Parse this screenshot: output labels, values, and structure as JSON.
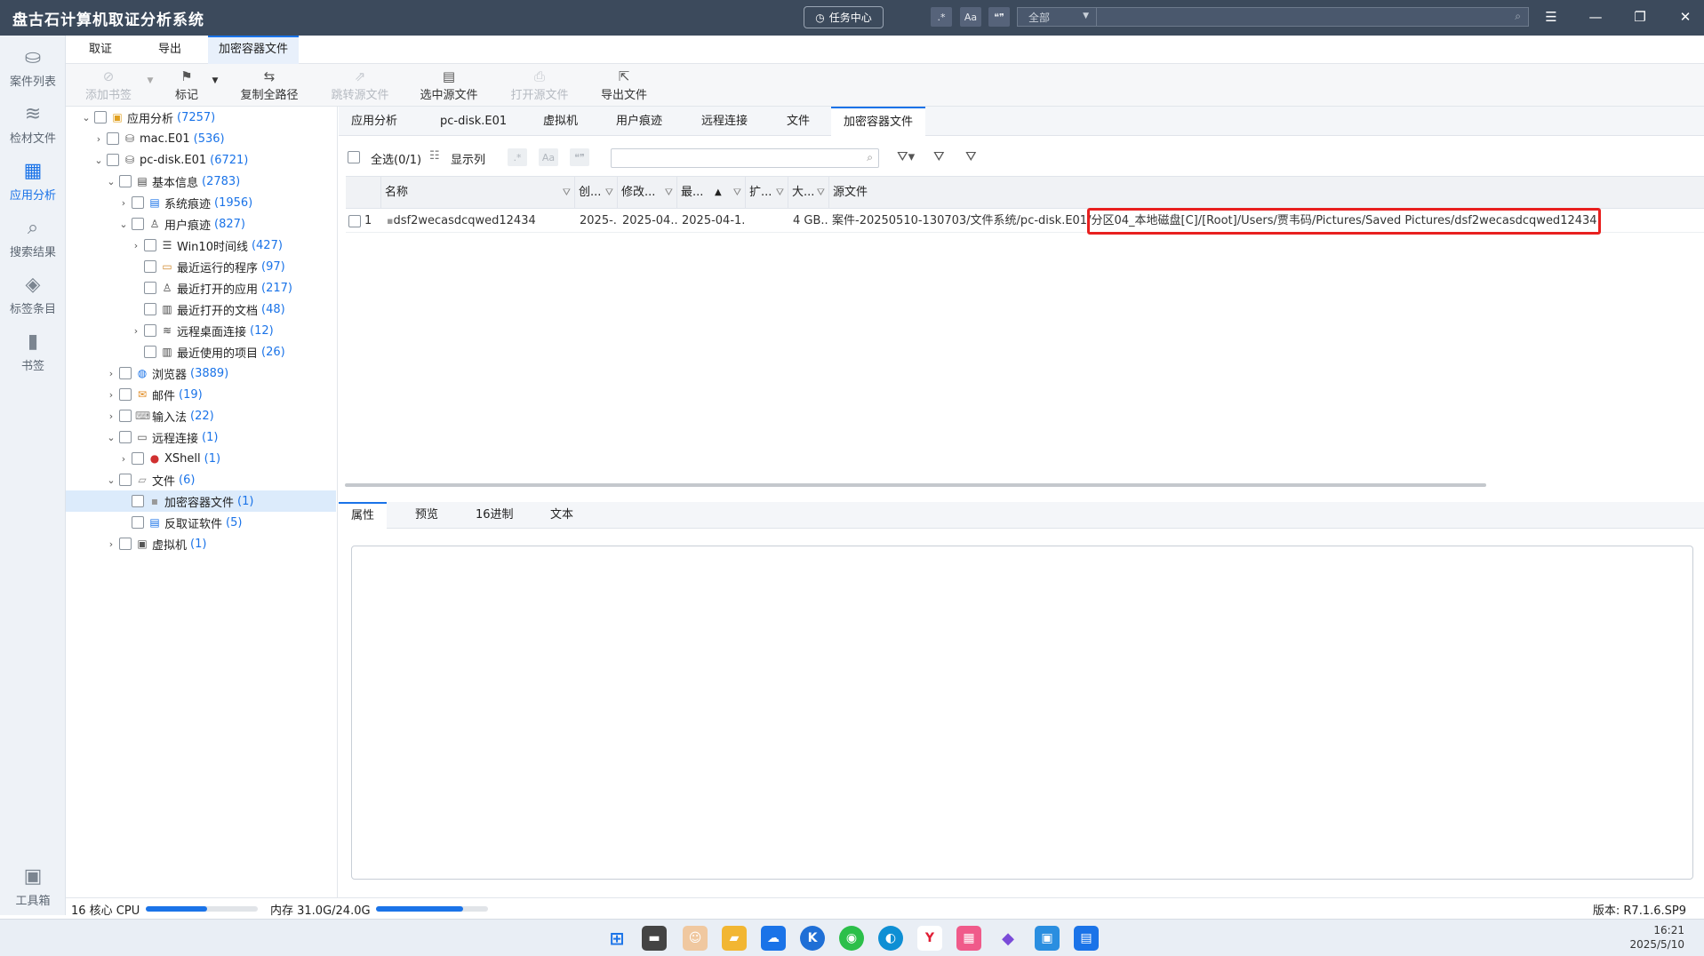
{
  "app": {
    "title": "盘古石计算机取证分析系统",
    "task_center": "任务中心",
    "scope": "全部"
  },
  "title_tools": [
    ".*",
    "Aa",
    "❝❞"
  ],
  "leftnav": [
    {
      "label": "案件列表",
      "icon": "case-list-icon"
    },
    {
      "label": "检材文件",
      "icon": "layers-icon"
    },
    {
      "label": "应用分析",
      "icon": "grid-apps-icon"
    },
    {
      "label": "搜索结果",
      "icon": "search-doc-icon"
    },
    {
      "label": "标签条目",
      "icon": "tag-icon"
    },
    {
      "label": "书签",
      "icon": "bookmark-icon"
    },
    {
      "label": "工具箱",
      "icon": "toolbox-icon"
    }
  ],
  "menu_tabs": [
    "取证",
    "导出",
    "加密容器文件"
  ],
  "toolbar": [
    {
      "label": "添加书签",
      "disabled": true
    },
    {
      "label": "标记",
      "disabled": false
    },
    {
      "label": "复制全路径",
      "disabled": false
    },
    {
      "label": "跳转源文件",
      "disabled": true
    },
    {
      "label": "选中源文件",
      "disabled": false
    },
    {
      "label": "打开源文件",
      "disabled": true
    },
    {
      "label": "导出文件",
      "disabled": false
    }
  ],
  "tree": [
    {
      "label": "应用分析",
      "count": "(7257)"
    },
    {
      "label": "mac.E01",
      "count": "(536)"
    },
    {
      "label": "pc-disk.E01",
      "count": "(6721)"
    },
    {
      "label": "基本信息",
      "count": "(2783)"
    },
    {
      "label": "系统痕迹",
      "count": "(1956)"
    },
    {
      "label": "用户痕迹",
      "count": "(827)"
    },
    {
      "label": "Win10时间线",
      "count": "(427)"
    },
    {
      "label": "最近运行的程序",
      "count": "(97)"
    },
    {
      "label": "最近打开的应用",
      "count": "(217)"
    },
    {
      "label": "最近打开的文档",
      "count": "(48)"
    },
    {
      "label": "远程桌面连接",
      "count": "(12)"
    },
    {
      "label": "最近使用的项目",
      "count": "(26)"
    },
    {
      "label": "浏览器",
      "count": "(3889)"
    },
    {
      "label": "邮件",
      "count": "(19)"
    },
    {
      "label": "输入法",
      "count": "(22)"
    },
    {
      "label": "远程连接",
      "count": "(1)"
    },
    {
      "label": "XShell",
      "count": "(1)"
    },
    {
      "label": "文件",
      "count": "(6)"
    },
    {
      "label": "加密容器文件",
      "count": "(1)"
    },
    {
      "label": "反取证软件",
      "count": "(5)"
    },
    {
      "label": "虚拟机",
      "count": "(1)"
    }
  ],
  "content_tabs": [
    "应用分析",
    "pc-disk.E01",
    "虚拟机",
    "用户痕迹",
    "远程连接",
    "文件",
    "加密容器文件"
  ],
  "filterbar": {
    "select_all": "全选(0/1)",
    "show_columns": "显示列"
  },
  "grid": {
    "columns": [
      "名称",
      "创...",
      "修改...",
      "最...",
      "扩...",
      "大...",
      "源文件"
    ],
    "rows": [
      {
        "index": "1",
        "name": "dsf2wecasdcqwed12434",
        "created": "2025-...",
        "modified": "2025-04...",
        "accessed": "2025-04-1...",
        "ext": "",
        "size": "4 GB...",
        "source_prefix": "案件-20250510-130703/文件系统/pc-disk.E01/",
        "source_suffix": "分区04_本地磁盘[C]/[Root]/Users/贾韦码/Pictures/Saved Pictures/dsf2wecasdcqwed12434"
      }
    ]
  },
  "detail_tabs": [
    "属性",
    "预览",
    "16进制",
    "文本"
  ],
  "status": {
    "cpu": "16 核心 CPU",
    "cpu_usage": 0.55,
    "mem": "内存 31.0G/24.0G",
    "mem_usage": 0.78,
    "version": "版本: R7.1.6.SP9"
  },
  "clock": {
    "time": "16:21",
    "date": "2025/5/10"
  },
  "colors": {
    "titlebar": "#3c4a5c",
    "accent": "#1a73e8",
    "highlight_border": "#e8201f"
  }
}
